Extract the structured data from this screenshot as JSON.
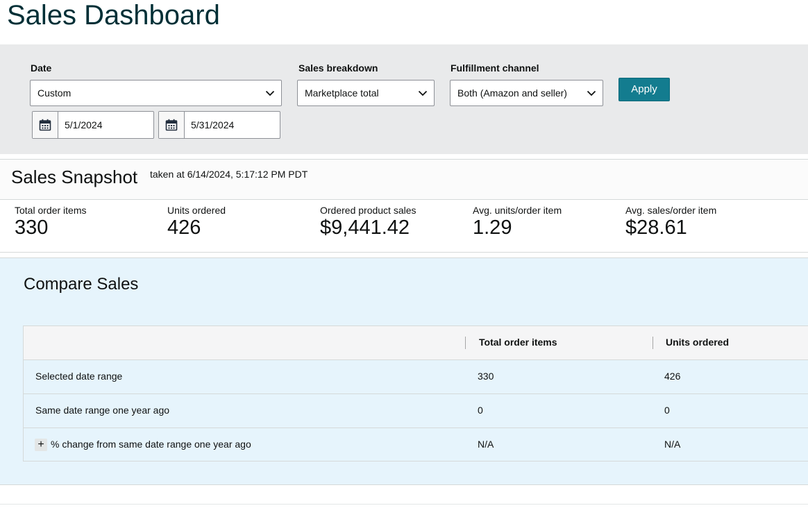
{
  "page": {
    "title": "Sales Dashboard"
  },
  "filters": {
    "date": {
      "label": "Date",
      "value": "Custom",
      "start": "5/1/2024",
      "end": "5/31/2024"
    },
    "breakdown": {
      "label": "Sales breakdown",
      "value": "Marketplace total"
    },
    "fulfillment": {
      "label": "Fulfillment channel",
      "value": "Both (Amazon and seller)"
    },
    "apply_label": "Apply"
  },
  "snapshot": {
    "title": "Sales Snapshot",
    "taken": "taken at 6/14/2024, 5:17:12 PM PDT",
    "metrics": [
      {
        "label": "Total order items",
        "value": "330"
      },
      {
        "label": "Units ordered",
        "value": "426"
      },
      {
        "label": "Ordered product sales",
        "value": "$9,441.42"
      },
      {
        "label": "Avg. units/order item",
        "value": "1.29"
      },
      {
        "label": "Avg. sales/order item",
        "value": "$28.61"
      }
    ]
  },
  "compare": {
    "title": "Compare Sales",
    "columns": [
      "",
      "Total order items",
      "Units ordered"
    ],
    "rows": [
      {
        "label": "Selected date range",
        "total_order_items": "330",
        "units_ordered": "426"
      },
      {
        "label": "Same date range one year ago",
        "total_order_items": "0",
        "units_ordered": "0"
      },
      {
        "label": "% change from same date range one year ago",
        "total_order_items": "N/A",
        "units_ordered": "N/A",
        "expand_icon": "plus-icon"
      }
    ]
  },
  "icons": {
    "dropdown": "chevron-down-icon",
    "calendar": "calendar-icon"
  },
  "colors": {
    "title": "#002f36",
    "apply_button": "#137c8f",
    "compare_bg": "#e6f4fc",
    "filter_bg": "#e9eaeb"
  }
}
